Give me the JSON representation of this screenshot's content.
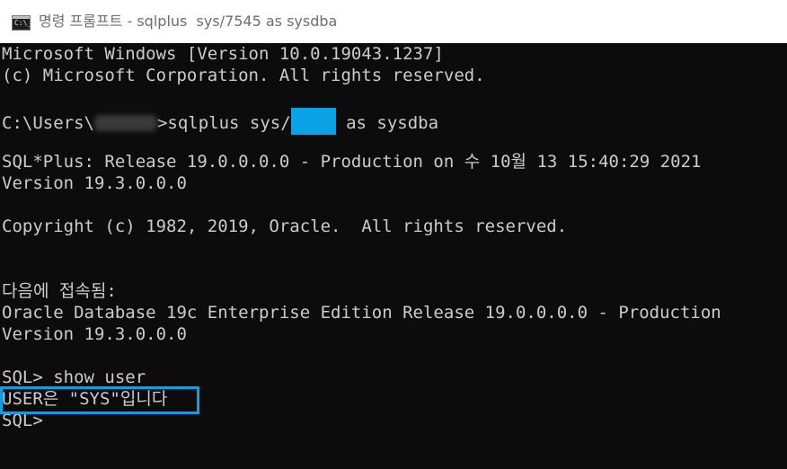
{
  "window": {
    "title": "명령 프롬프트 - sqlplus  sys/7545 as sysdba",
    "icon": "cmd-icon",
    "icon_glyph": "C:\\_"
  },
  "console": {
    "lines": [
      "Microsoft Windows [Version 10.0.19043.1237]",
      "(c) Microsoft Corporation. All rights reserved.",
      "",
      "",
      "SQL*Plus: Release 19.0.0.0.0 - Production on 수 10월 13 15:40:29 2021",
      "Version 19.3.0.0.0",
      "",
      "Copyright (c) 1982, 2019, Oracle.  All rights reserved.",
      "",
      "",
      "다음에 접속됨:",
      "Oracle Database 19c Enterprise Edition Release 19.0.0.0.0 - Production",
      "Version 19.3.0.0.0",
      "",
      "SQL> show user",
      "USER은 \"SYS\"입니다",
      "SQL>"
    ],
    "command": {
      "prefix": "C:\\Users\\",
      "prompt_suffix": ">sqlplus sys/",
      "suffix": " as sysdba"
    }
  },
  "colors": {
    "console_bg": "#0c0c0c",
    "console_text": "#cccccc",
    "highlight_border": "#149cde",
    "mask_fill": "#0aa3e5"
  }
}
